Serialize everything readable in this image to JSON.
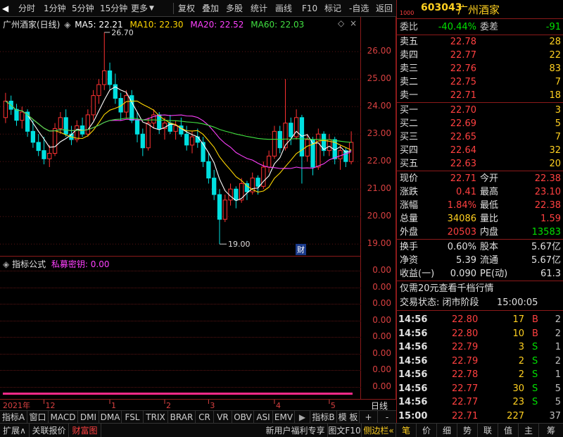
{
  "toolbar": {
    "left_items": [
      "分时",
      "1分钟",
      "5分钟",
      "15分钟",
      "更多"
    ],
    "right_items": [
      "复权",
      "叠加",
      "多股",
      "统计",
      "画线",
      "F10",
      "标记",
      "-自选",
      "返回"
    ]
  },
  "stock": {
    "code": "603043",
    "name": "广州酒家",
    "badge": "1000"
  },
  "kline_header": {
    "title": "广州酒家(日线)",
    "ma": [
      {
        "label": "MA5: 22.21",
        "color": "#ffffff"
      },
      {
        "label": "MA10: 22.30",
        "color": "#ffd700"
      },
      {
        "label": "MA20: 22.52",
        "color": "#ff40ff"
      },
      {
        "label": "MA60: 22.03",
        "color": "#40e040"
      }
    ]
  },
  "chart_data": {
    "type": "candlestick",
    "title": "广州酒家(日线)",
    "y_ticks": [
      26.0,
      25.0,
      24.0,
      23.0,
      22.0,
      21.0,
      20.0,
      19.0
    ],
    "ylim": [
      18.75,
      26.8
    ],
    "high_marker": "26.70",
    "low_marker": "19.00",
    "high_value": 26.7,
    "low_value": 19.0,
    "ma": {
      "MA5": 22.21,
      "MA10": 22.3,
      "MA20": 22.52,
      "MA60": 22.03
    },
    "x_labels": [
      "2021年",
      "12",
      "1",
      "2",
      "3",
      "4",
      "5"
    ],
    "cai_badge": "财",
    "candles": [
      [
        23.6,
        24.5,
        23.4,
        24.2
      ],
      [
        24.2,
        24.4,
        23.7,
        23.9
      ],
      [
        23.9,
        24.1,
        23.3,
        23.5
      ],
      [
        23.5,
        24.0,
        23.2,
        23.8
      ],
      [
        23.8,
        23.9,
        22.9,
        23.1
      ],
      [
        23.1,
        23.5,
        22.5,
        22.7
      ],
      [
        22.7,
        23.0,
        22.2,
        22.4
      ],
      [
        22.4,
        22.9,
        21.9,
        22.1
      ],
      [
        22.1,
        22.6,
        21.8,
        22.3
      ],
      [
        22.3,
        23.4,
        22.2,
        23.2
      ],
      [
        23.2,
        23.8,
        23.0,
        23.6
      ],
      [
        23.6,
        23.9,
        22.9,
        23.0
      ],
      [
        23.0,
        23.3,
        22.6,
        22.8
      ],
      [
        22.8,
        23.5,
        22.7,
        23.3
      ],
      [
        23.3,
        23.6,
        22.9,
        23.0
      ],
      [
        23.0,
        23.9,
        22.9,
        23.7
      ],
      [
        23.7,
        24.6,
        23.5,
        24.4
      ],
      [
        24.4,
        25.0,
        24.1,
        24.8
      ],
      [
        24.8,
        26.7,
        24.6,
        25.3
      ],
      [
        25.3,
        25.6,
        24.6,
        24.8
      ],
      [
        24.8,
        25.2,
        24.1,
        24.3
      ],
      [
        24.3,
        24.5,
        23.5,
        23.8
      ],
      [
        23.8,
        24.6,
        23.6,
        24.4
      ],
      [
        24.4,
        24.6,
        23.4,
        23.5
      ],
      [
        23.5,
        23.8,
        22.7,
        23.0
      ],
      [
        23.0,
        23.2,
        22.2,
        22.5
      ],
      [
        22.5,
        23.6,
        22.4,
        23.4
      ],
      [
        23.4,
        23.9,
        23.2,
        23.7
      ],
      [
        23.7,
        23.8,
        23.0,
        23.2
      ],
      [
        23.2,
        23.6,
        22.8,
        23.4
      ],
      [
        23.4,
        23.7,
        23.0,
        23.1
      ],
      [
        23.1,
        23.5,
        22.8,
        23.3
      ],
      [
        23.3,
        23.6,
        22.9,
        23.0
      ],
      [
        23.0,
        23.3,
        22.4,
        22.6
      ],
      [
        22.6,
        23.1,
        22.3,
        22.9
      ],
      [
        22.9,
        23.2,
        22.5,
        22.7
      ],
      [
        22.7,
        22.9,
        21.8,
        22.0
      ],
      [
        22.0,
        22.3,
        21.2,
        21.4
      ],
      [
        21.4,
        21.7,
        20.6,
        20.8
      ],
      [
        20.8,
        21.0,
        19.0,
        19.9
      ],
      [
        19.9,
        20.8,
        19.8,
        20.6
      ],
      [
        20.6,
        21.2,
        20.4,
        21.0
      ],
      [
        21.0,
        21.1,
        20.3,
        20.6
      ],
      [
        20.6,
        21.4,
        20.5,
        21.2
      ],
      [
        21.2,
        21.3,
        20.6,
        20.9
      ],
      [
        20.9,
        21.6,
        20.8,
        21.4
      ],
      [
        21.4,
        21.5,
        20.8,
        21.1
      ],
      [
        21.1,
        22.0,
        21.0,
        21.8
      ],
      [
        21.8,
        22.4,
        21.6,
        22.2
      ],
      [
        22.2,
        23.3,
        22.1,
        23.1
      ],
      [
        23.1,
        23.3,
        22.3,
        22.5
      ],
      [
        22.5,
        25.0,
        22.4,
        23.4
      ],
      [
        23.4,
        23.6,
        22.6,
        22.9
      ],
      [
        22.9,
        23.9,
        22.8,
        23.6
      ],
      [
        23.6,
        23.7,
        21.2,
        22.2
      ],
      [
        22.2,
        23.0,
        22.0,
        22.8
      ],
      [
        22.8,
        22.9,
        21.5,
        21.8
      ],
      [
        21.8,
        23.2,
        21.7,
        23.0
      ],
      [
        23.0,
        23.1,
        22.2,
        22.4
      ],
      [
        22.4,
        23.0,
        22.2,
        22.8
      ],
      [
        22.8,
        22.9,
        21.9,
        22.1
      ],
      [
        22.1,
        22.6,
        21.7,
        22.4
      ],
      [
        22.4,
        22.5,
        21.8,
        22.0
      ],
      [
        22.0,
        23.1,
        21.9,
        22.7
      ]
    ]
  },
  "indicator": {
    "title": "指标公式",
    "subtitle": "私募密钥: 0.00",
    "y_labels": [
      "0.00",
      "0.00",
      "0.00",
      "0.00",
      "0.00",
      "0.00",
      "0.00",
      "0.00"
    ]
  },
  "date_bar": {
    "right_label": "日线"
  },
  "tabs": [
    "指标A",
    "窗口",
    "MACD",
    "DMI",
    "DMA",
    "FSL",
    "TRIX",
    "BRAR",
    "CR",
    "VR",
    "OBV",
    "ASI",
    "EMV",
    "指标B",
    "模 板",
    "+",
    "-"
  ],
  "bottom_left": [
    "扩展∧",
    "关联报价",
    "财富图"
  ],
  "bottom_mid": [
    "新用户福利专享",
    "图文F10",
    "侧边栏«"
  ],
  "bottom_right": [
    "笔",
    "价",
    "细",
    "势",
    "联",
    "值",
    "主",
    "筹"
  ],
  "quote": {
    "weibi": {
      "label": "委比",
      "value": "-40.44%",
      "label2": "委差",
      "value2": "-91"
    },
    "asks": [
      {
        "label": "卖五",
        "price": "22.78",
        "vol": "28"
      },
      {
        "label": "卖四",
        "price": "22.77",
        "vol": "22"
      },
      {
        "label": "卖三",
        "price": "22.76",
        "vol": "83"
      },
      {
        "label": "卖二",
        "price": "22.75",
        "vol": "7"
      },
      {
        "label": "卖一",
        "price": "22.71",
        "vol": "18"
      }
    ],
    "bids": [
      {
        "label": "买一",
        "price": "22.70",
        "vol": "3"
      },
      {
        "label": "买二",
        "price": "22.69",
        "vol": "5"
      },
      {
        "label": "买三",
        "price": "22.65",
        "vol": "7"
      },
      {
        "label": "买四",
        "price": "22.64",
        "vol": "32"
      },
      {
        "label": "买五",
        "price": "22.63",
        "vol": "20"
      }
    ],
    "stats": [
      {
        "l1": "现价",
        "v1": "22.71",
        "c1": "red",
        "l2": "今开",
        "v2": "22.38",
        "c2": "red"
      },
      {
        "l1": "涨跌",
        "v1": "0.41",
        "c1": "red",
        "l2": "最高",
        "v2": "23.10",
        "c2": "red"
      },
      {
        "l1": "涨幅",
        "v1": "1.84%",
        "c1": "red",
        "l2": "最低",
        "v2": "22.38",
        "c2": "red"
      },
      {
        "l1": "总量",
        "v1": "34086",
        "c1": "yellow",
        "l2": "量比",
        "v2": "1.59",
        "c2": "red"
      },
      {
        "l1": "外盘",
        "v1": "20503",
        "c1": "red",
        "l2": "内盘",
        "v2": "13583",
        "c2": "green"
      }
    ],
    "stats2": [
      {
        "l1": "换手",
        "v1": "0.60%",
        "l2": "股本",
        "v2": "5.67亿"
      },
      {
        "l1": "净资",
        "v1": "5.39",
        "l2": "流通",
        "v2": "5.67亿"
      },
      {
        "l1": "收益(一)",
        "v1": "0.090",
        "l2": "PE(动)",
        "v2": "61.3"
      }
    ],
    "promo": "仅需20元查看千档行情",
    "trade_status_label": "交易状态: 闭市阶段",
    "trade_status_time": "15:00:05",
    "ticks": [
      {
        "time": "14:56",
        "price": "22.80",
        "vol": "17",
        "side": "B",
        "n": "2"
      },
      {
        "time": "14:56",
        "price": "22.80",
        "vol": "10",
        "side": "B",
        "n": "2"
      },
      {
        "time": "14:56",
        "price": "22.79",
        "vol": "3",
        "side": "S",
        "n": "1"
      },
      {
        "time": "14:56",
        "price": "22.79",
        "vol": "2",
        "side": "S",
        "n": "2"
      },
      {
        "time": "14:56",
        "price": "22.78",
        "vol": "2",
        "side": "S",
        "n": "1"
      },
      {
        "time": "14:56",
        "price": "22.77",
        "vol": "30",
        "side": "S",
        "n": "5"
      },
      {
        "time": "14:56",
        "price": "22.77",
        "vol": "23",
        "side": "S",
        "n": "5"
      },
      {
        "time": "15:00",
        "price": "22.71",
        "vol": "227",
        "side": "",
        "n": "37"
      }
    ]
  },
  "colors": {
    "up": "#ff3232",
    "down": "#00e0e0",
    "border": "#8b1a1a"
  }
}
